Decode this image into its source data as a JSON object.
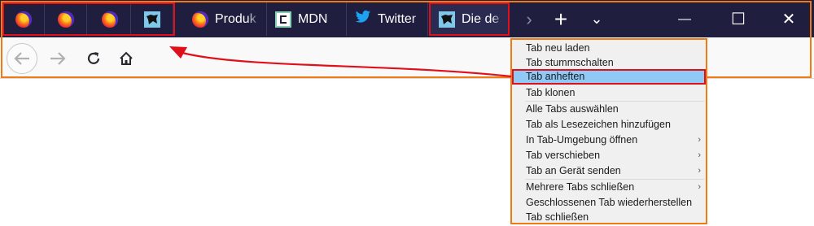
{
  "tabs": {
    "pinned": [
      {
        "icon": "firefox-icon"
      },
      {
        "icon": "firefox-icon"
      },
      {
        "icon": "firefox-icon"
      },
      {
        "icon": "black-panther-site-icon"
      }
    ],
    "normal": [
      {
        "label": "Produk",
        "icon": "firefox-icon"
      },
      {
        "label": "MDN",
        "icon": "mdn-icon"
      },
      {
        "label": "Twitter",
        "icon": "twitter-bird-icon"
      },
      {
        "label": "Die de",
        "icon": "black-panther-site-icon"
      }
    ]
  },
  "titlebar": {
    "overflow_icon": "›",
    "new_tab_icon": "+",
    "list_all_icon": "⌄",
    "minimize_icon": "—",
    "maximize_icon": "☐",
    "close_icon": "✕"
  },
  "toolbar": {
    "back": "back-arrow-icon",
    "forward": "forward-arrow-icon",
    "reload": "reload-icon",
    "home": "home-icon"
  },
  "context_menu": {
    "items": [
      {
        "label": "Tab neu laden"
      },
      {
        "label": "Tab stummschalten"
      },
      {
        "label": "Tab anheften",
        "highlighted": true
      },
      {
        "label": "Tab klonen"
      },
      {
        "label": "Alle Tabs auswählen"
      },
      {
        "label": "Tab als Lesezeichen hinzufügen"
      },
      {
        "label": "In Tab-Umgebung öffnen",
        "submenu": true
      },
      {
        "label": "Tab verschieben",
        "submenu": true
      },
      {
        "label": "Tab an Gerät senden",
        "submenu": true
      },
      {
        "label": "Mehrere Tabs schließen",
        "submenu": true
      },
      {
        "label": "Geschlossenen Tab wiederherstellen"
      },
      {
        "label": "Tab schließen"
      }
    ]
  },
  "colors": {
    "titlebar": "#1f1e3f",
    "highlight_frame": "#e0101a",
    "outer_frame": "#f07a14",
    "menu_highlight": "#90c8f6"
  }
}
